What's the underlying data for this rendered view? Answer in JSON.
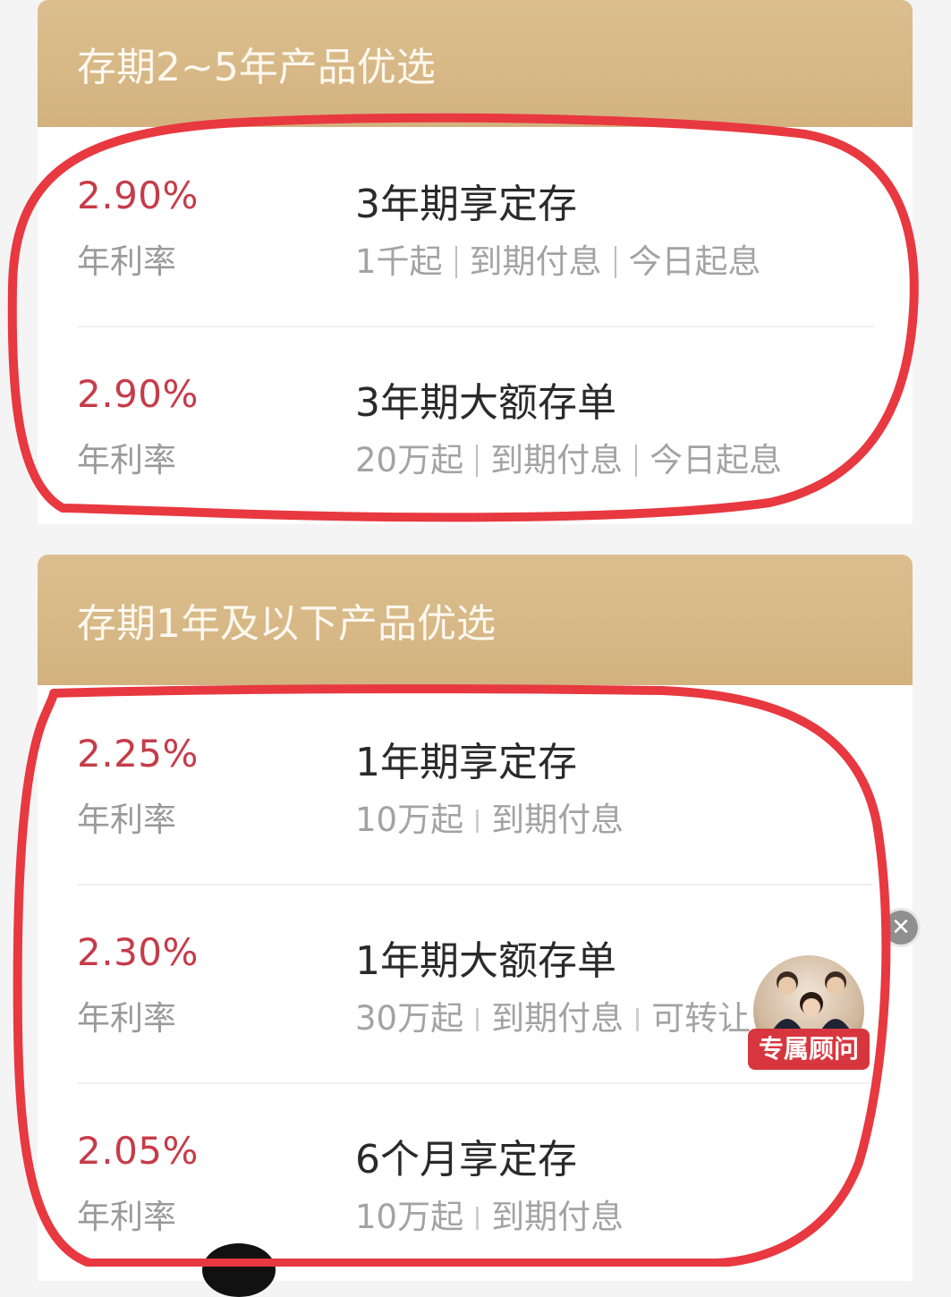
{
  "sections": [
    {
      "title": "存期2~5年产品优选",
      "products": [
        {
          "rate": "2.90%",
          "rate_label": "年利率",
          "name": "3年期享定存",
          "tags": [
            "1千起",
            "到期付息",
            "今日起息"
          ]
        },
        {
          "rate": "2.90%",
          "rate_label": "年利率",
          "name": "3年期大额存单",
          "tags": [
            "20万起",
            "到期付息",
            "今日起息"
          ]
        }
      ]
    },
    {
      "title": "存期1年及以下产品优选",
      "products": [
        {
          "rate": "2.25%",
          "rate_label": "年利率",
          "name": "1年期享定存",
          "tags": [
            "10万起",
            "到期付息"
          ]
        },
        {
          "rate": "2.30%",
          "rate_label": "年利率",
          "name": "1年期大额存单",
          "tags": [
            "30万起",
            "到期付息",
            "可转让"
          ]
        },
        {
          "rate": "2.05%",
          "rate_label": "年利率",
          "name": "6个月享定存",
          "tags": [
            "10万起",
            "到期付息"
          ]
        }
      ]
    }
  ],
  "advisor": {
    "badge": "专属顾问",
    "close_glyph": "✕"
  },
  "colors": {
    "header_gold": "#d3b27f",
    "rate_red": "#c63c49",
    "annotation_red": "#e83840"
  }
}
